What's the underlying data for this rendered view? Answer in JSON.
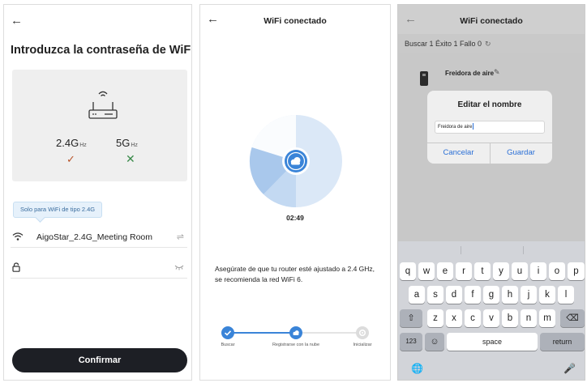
{
  "screen1": {
    "back_icon": "arrow-left-icon",
    "title": "Introduzca la contraseña de WiFi",
    "band_24": "2.4G",
    "band_24_unit": "Hz",
    "band_5": "5G",
    "band_5_unit": "Hz",
    "band_24_status": "✓",
    "band_5_status": "✕",
    "tooltip": "Solo para WiFi de tipo 2.4G",
    "ssid": "AigoStar_2.4G_Meeting Room",
    "password_value": "",
    "confirm_label": "Confirmar",
    "colors": {
      "check": "#b8542a",
      "cross": "#3a8a4a",
      "button": "#1d1f25"
    }
  },
  "screen2": {
    "back_icon": "arrow-left-icon",
    "title": "WiFi conectado",
    "timer": "02:49",
    "note": "Asegúrate de que tu router esté ajustado a 2.4 GHz, se recomienda la red WiFi 6.",
    "steps": [
      {
        "label": "Buscar",
        "state": "done"
      },
      {
        "label": "Registrarse con la nube",
        "state": "active"
      },
      {
        "label": "Inicializar",
        "state": "pending"
      }
    ],
    "colors": {
      "accent": "#3a84d8",
      "radar_light": "#dbe8f7",
      "radar_mid": "#a9c8ec",
      "pending": "#d9d9d9"
    }
  },
  "screen3": {
    "back_icon": "arrow-left-icon",
    "title": "WiFi conectado",
    "status": "Buscar 1  Éxito 1  Fallo 0",
    "device_name": "Freidora de aire",
    "dialog": {
      "title": "Editar el nombre",
      "input_value": "Freidora de aire",
      "cancel_label": "Cancelar",
      "save_label": "Guardar"
    },
    "keyboard": {
      "row1": [
        "q",
        "w",
        "e",
        "r",
        "t",
        "y",
        "u",
        "i",
        "o",
        "p"
      ],
      "row2": [
        "a",
        "s",
        "d",
        "f",
        "g",
        "h",
        "j",
        "k",
        "l"
      ],
      "row3": [
        "z",
        "x",
        "c",
        "v",
        "b",
        "n",
        "m"
      ],
      "numbers_key": "123",
      "space_key": "space",
      "return_key": "return"
    }
  }
}
